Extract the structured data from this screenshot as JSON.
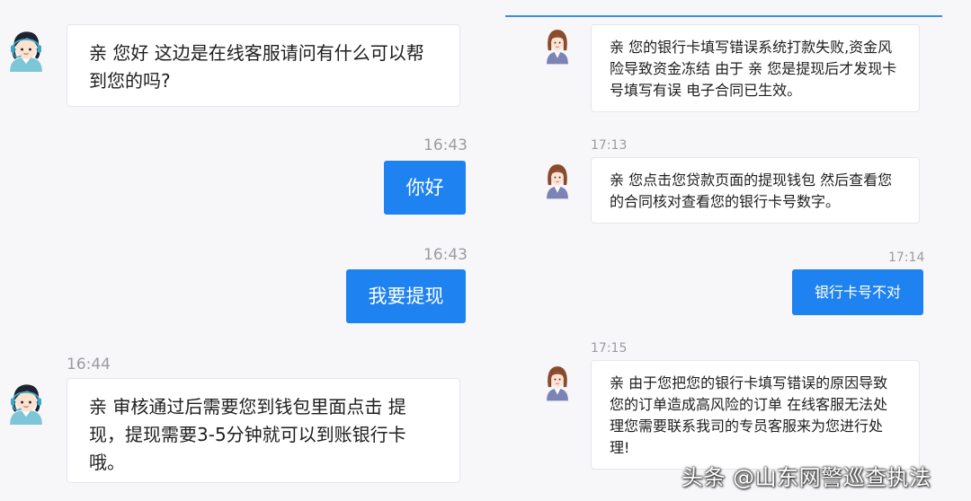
{
  "left_chat": {
    "messages": [
      {
        "text": "亲 您好 这边是在线客服请问有什么可以帮到您的吗?"
      },
      {
        "time": "16:43",
        "text": "你好"
      },
      {
        "time": "16:43",
        "text": "我要提现"
      },
      {
        "time": "16:44",
        "text": "亲 审核通过后需要您到钱包里面点击 提现，提现需要3-5分钟就可以到账银行卡哦。"
      }
    ]
  },
  "right_chat": {
    "messages": [
      {
        "text": "亲 您的银行卡填写错误系统打款失败,资金风险导致资金冻结 由于 亲 您是提现后才发现卡号填写有误 电子合同已生效。"
      },
      {
        "time": "17:13",
        "text": "亲 您点击您贷款页面的提现钱包 然后查看您的合同核对查看您的银行卡号数字。"
      },
      {
        "time": "17:14",
        "text": "银行卡号不对"
      },
      {
        "time": "17:15",
        "text": "亲 由于您把您的银行卡填写错误的原因导致您的订单造成高风险的订单 在线客服无法处理您需要联系我司的专员客服来为您进行处理!"
      }
    ]
  },
  "watermark": "头条 @山东网警巡查执法",
  "colors": {
    "accent": "#1e82f0",
    "timestamp": "#9a9ca0",
    "bubble_border": "#e4e6ea",
    "topline": "#3c8ee0"
  },
  "icons": {
    "agent_avatar_left": "customer-service-agent-avatar",
    "agent_avatar_right": "woman-agent-avatar"
  }
}
